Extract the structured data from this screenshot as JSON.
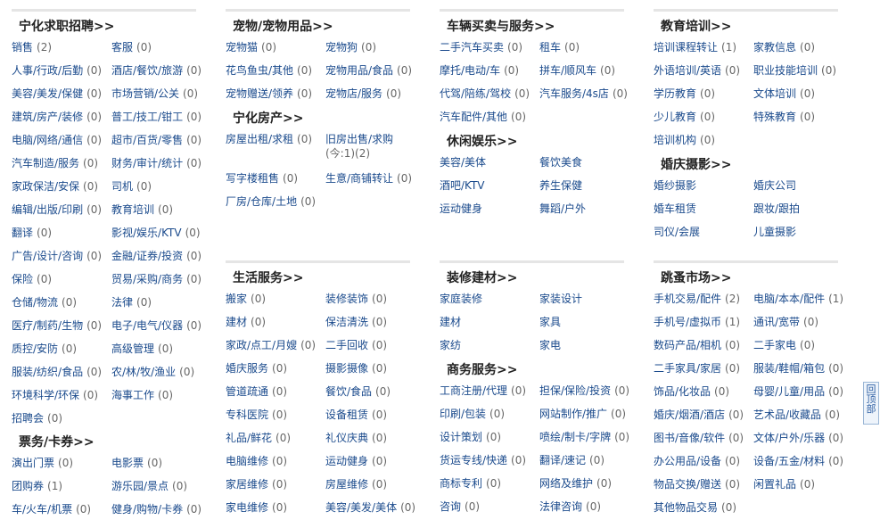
{
  "columns": [
    {
      "sections": [
        {
          "title": "宁化求职招聘>>",
          "items": [
            [
              "销售",
              "(2)"
            ],
            [
              "客服",
              "(0)"
            ],
            [
              "人事/行政/后勤",
              "(0)"
            ],
            [
              "酒店/餐饮/旅游",
              "(0)"
            ],
            [
              "美容/美发/保健",
              "(0)"
            ],
            [
              "市场营销/公关",
              "(0)"
            ],
            [
              "建筑/房产/装修",
              "(0)"
            ],
            [
              "普工/技工/钳工",
              "(0)"
            ],
            [
              "电脑/网络/通信",
              "(0)"
            ],
            [
              "超市/百货/零售",
              "(0)"
            ],
            [
              "汽车制造/服务",
              "(0)"
            ],
            [
              "财务/审计/统计",
              "(0)"
            ],
            [
              "家政保洁/安保",
              "(0)"
            ],
            [
              "司机",
              "(0)"
            ],
            [
              "编辑/出版/印刷",
              "(0)"
            ],
            [
              "教育培训",
              "(0)"
            ],
            [
              "翻译",
              "(0)"
            ],
            [
              "影视/娱乐/KTV",
              "(0)"
            ],
            [
              "广告/设计/咨询",
              "(0)"
            ],
            [
              "金融/证券/投资",
              "(0)"
            ],
            [
              "保险",
              "(0)"
            ],
            [
              "贸易/采购/商务",
              "(0)"
            ],
            [
              "仓储/物流",
              "(0)"
            ],
            [
              "法律",
              "(0)"
            ],
            [
              "医疗/制药/生物",
              "(0)"
            ],
            [
              "电子/电气/仪器",
              "(0)"
            ],
            [
              "质控/安防",
              "(0)"
            ],
            [
              "高级管理",
              "(0)"
            ],
            [
              "服装/纺织/食品",
              "(0)"
            ],
            [
              "农/林/牧/渔业",
              "(0)"
            ],
            [
              "环境科学/环保",
              "(0)"
            ],
            [
              "海事工作",
              "(0)"
            ],
            [
              "招聘会",
              "(0)"
            ]
          ]
        },
        {
          "title": "票务/卡券>>",
          "items": [
            [
              "演出门票",
              "(0)"
            ],
            [
              "电影票",
              "(0)"
            ],
            [
              "团购券",
              "(1)"
            ],
            [
              "游乐园/景点",
              "(0)"
            ],
            [
              "车/火车/机票",
              "(0)"
            ],
            [
              "健身/购物/卡券",
              "(0)"
            ]
          ]
        }
      ]
    },
    {
      "sections": [
        {
          "title": "宠物/宠物用品>>",
          "items": [
            [
              "宠物猫",
              "(0)"
            ],
            [
              "宠物狗",
              "(0)"
            ],
            [
              "花鸟鱼虫/其他",
              "(0)"
            ],
            [
              "宠物用品/食品",
              "(0)"
            ],
            [
              "宠物赠送/领养",
              "(0)"
            ],
            [
              "宠物店/服务",
              "(0)"
            ]
          ]
        },
        {
          "title": "宁化房产>>",
          "items": [
            [
              "房屋出租/求租",
              "(0)"
            ],
            [
              "旧房出售/求购",
              "(今:1)(2)"
            ],
            [
              "写字楼租售",
              "(0)"
            ],
            [
              "生意/商铺转让",
              "(0)"
            ],
            [
              "厂房/仓库/土地",
              "(0)"
            ]
          ]
        },
        {
          "title": "生活服务>>",
          "items": [
            [
              "搬家",
              "(0)"
            ],
            [
              "装修装饰",
              "(0)"
            ],
            [
              "建材",
              "(0)"
            ],
            [
              "保洁清洗",
              "(0)"
            ],
            [
              "家政/点工/月嫂",
              "(0)"
            ],
            [
              "二手回收",
              "(0)"
            ],
            [
              "婚庆服务",
              "(0)"
            ],
            [
              "摄影摄像",
              "(0)"
            ],
            [
              "管道疏通",
              "(0)"
            ],
            [
              "餐饮/食品",
              "(0)"
            ],
            [
              "专科医院",
              "(0)"
            ],
            [
              "设备租赁",
              "(0)"
            ],
            [
              "礼品/鲜花",
              "(0)"
            ],
            [
              "礼仪庆典",
              "(0)"
            ],
            [
              "电脑维修",
              "(0)"
            ],
            [
              "运动健身",
              "(0)"
            ],
            [
              "家居维修",
              "(0)"
            ],
            [
              "房屋维修",
              "(0)"
            ],
            [
              "家电维修",
              "(0)"
            ],
            [
              "美容/美发/美体",
              "(0)"
            ]
          ]
        }
      ]
    },
    {
      "sections": [
        {
          "title": "车辆买卖与服务>>",
          "items": [
            [
              "二手汽车买卖",
              "(0)"
            ],
            [
              "租车",
              "(0)"
            ],
            [
              "摩托/电动/车",
              "(0)"
            ],
            [
              "拼车/顺风车",
              "(0)"
            ],
            [
              "代驾/陪练/驾校",
              "(0)"
            ],
            [
              "汽车服务/4s店",
              "(0)"
            ],
            [
              "汽车配件/其他",
              "(0)"
            ]
          ]
        },
        {
          "title": "休闲娱乐>>",
          "items": [
            [
              "美容/美体",
              ""
            ],
            [
              "餐饮美食",
              ""
            ],
            [
              "酒吧/KTV",
              ""
            ],
            [
              "养生保健",
              ""
            ],
            [
              "运动健身",
              ""
            ],
            [
              "舞蹈/户外",
              ""
            ]
          ]
        },
        {
          "title": "装修建材>>",
          "items": [
            [
              "家庭装修",
              ""
            ],
            [
              "家装设计",
              ""
            ],
            [
              "建材",
              ""
            ],
            [
              "家具",
              ""
            ],
            [
              "家纺",
              ""
            ],
            [
              "家电",
              ""
            ]
          ]
        },
        {
          "title": "商务服务>>",
          "items": [
            [
              "工商注册/代理",
              "(0)"
            ],
            [
              "担保/保险/投资",
              "(0)"
            ],
            [
              "印刷/包装",
              "(0)"
            ],
            [
              "网站制作/推广",
              "(0)"
            ],
            [
              "设计策划",
              "(0)"
            ],
            [
              "喷绘/制卡/字牌",
              "(0)"
            ],
            [
              "货运专线/快递",
              "(0)"
            ],
            [
              "翻译/速记",
              "(0)"
            ],
            [
              "商标专利",
              "(0)"
            ],
            [
              "网络及维护",
              "(0)"
            ],
            [
              "咨询",
              "(0)"
            ],
            [
              "法律咨询",
              "(0)"
            ]
          ]
        }
      ]
    },
    {
      "sections": [
        {
          "title": "教育培训>>",
          "items": [
            [
              "培训课程转让",
              "(1)"
            ],
            [
              "家教信息",
              "(0)"
            ],
            [
              "外语培训/英语",
              "(0)"
            ],
            [
              "职业技能培训",
              "(0)"
            ],
            [
              "学历教育",
              "(0)"
            ],
            [
              "文体培训",
              "(0)"
            ],
            [
              "少儿教育",
              "(0)"
            ],
            [
              "特殊教育",
              "(0)"
            ],
            [
              "培训机构",
              "(0)"
            ]
          ]
        },
        {
          "title": "婚庆摄影>>",
          "items": [
            [
              "婚纱摄影",
              ""
            ],
            [
              "婚庆公司",
              ""
            ],
            [
              "婚车租赁",
              ""
            ],
            [
              "跟妆/跟拍",
              ""
            ],
            [
              "司仪/会展",
              ""
            ],
            [
              "儿童摄影",
              ""
            ]
          ]
        },
        {
          "title": "跳蚤市场>>",
          "items": [
            [
              "手机交易/配件",
              "(2)"
            ],
            [
              "电脑/本本/配件",
              "(1)"
            ],
            [
              "手机号/虚拟币",
              "(1)"
            ],
            [
              "通讯/宽带",
              "(0)"
            ],
            [
              "数码产品/相机",
              "(0)"
            ],
            [
              "二手家电",
              "(0)"
            ],
            [
              "二手家具/家居",
              "(0)"
            ],
            [
              "服装/鞋帽/箱包",
              "(0)"
            ],
            [
              "饰品/化妆品",
              "(0)"
            ],
            [
              "母婴/儿童/用品",
              "(0)"
            ],
            [
              "婚庆/烟酒/酒店",
              "(0)"
            ],
            [
              "艺术品/收藏品",
              "(0)"
            ],
            [
              "图书/音像/软件",
              "(0)"
            ],
            [
              "文体/户外/乐器",
              "(0)"
            ],
            [
              "办公用品/设备",
              "(0)"
            ],
            [
              "设备/五金/材料",
              "(0)"
            ],
            [
              "物品交换/赠送",
              "(0)"
            ],
            [
              "闲置礼品",
              "(0)"
            ],
            [
              "其他物品交易",
              "(0)"
            ]
          ]
        }
      ]
    }
  ],
  "backtop": "回顶部"
}
